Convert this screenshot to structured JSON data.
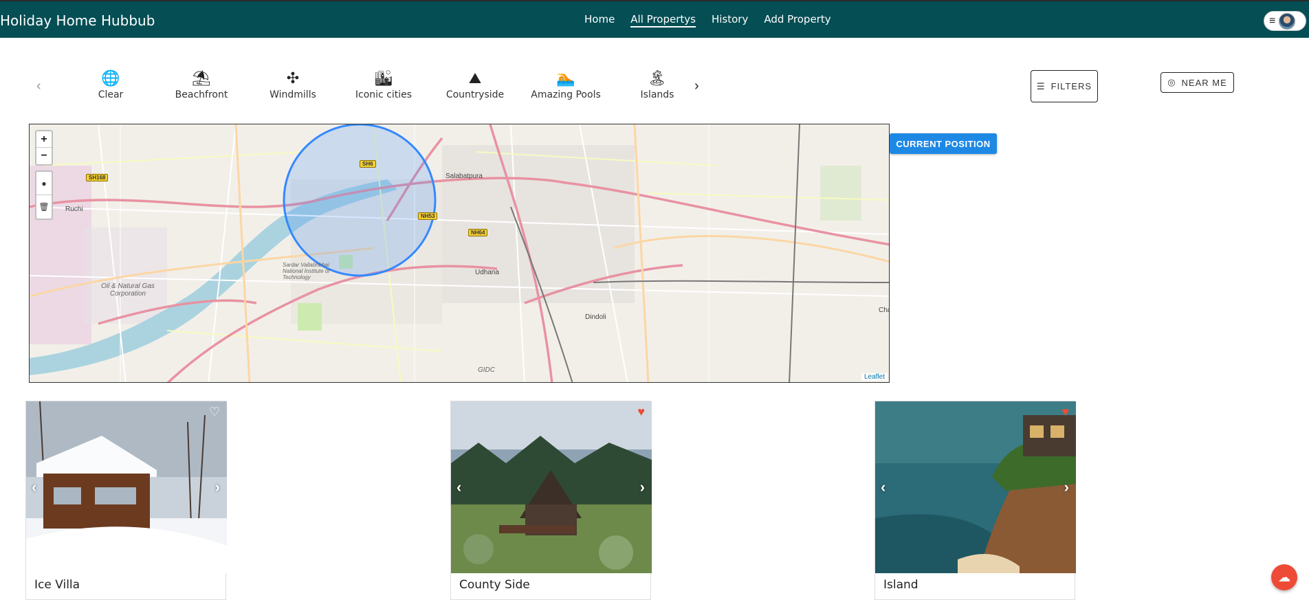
{
  "app": {
    "title": "Holiday Home Hubbub"
  },
  "nav": {
    "items": [
      {
        "label": "Home",
        "active": false
      },
      {
        "label": "All Propertys",
        "active": true
      },
      {
        "label": "History",
        "active": false
      },
      {
        "label": "Add Property",
        "active": false
      }
    ]
  },
  "user_menu": {
    "menu_icon": "hamburger-icon",
    "avatar": "user-avatar"
  },
  "categories": {
    "prev_arrow": "‹",
    "next_arrow": "›",
    "items": [
      {
        "label": "Clear",
        "icon": "globe-icon",
        "glyph": "🌐"
      },
      {
        "label": "Beachfront",
        "icon": "beach-umbrella-icon",
        "glyph": "⛱"
      },
      {
        "label": "Windmills",
        "icon": "windmill-icon",
        "glyph": "✣"
      },
      {
        "label": "Iconic cities",
        "icon": "city-icon",
        "glyph": "🏙"
      },
      {
        "label": "Countryside",
        "icon": "mountain-icon",
        "glyph": "⛰"
      },
      {
        "label": "Amazing Pools",
        "icon": "pool-icon",
        "glyph": "🏊"
      },
      {
        "label": "Islands",
        "icon": "island-icon",
        "glyph": "🏝"
      }
    ]
  },
  "filters_button": {
    "label": "FILTERS",
    "icon": "filter-sliders-icon"
  },
  "near_me_button": {
    "label": "NEAR ME",
    "icon": "location-target-icon"
  },
  "current_position_button": {
    "label": "CURRENT POSITION"
  },
  "map": {
    "zoom_in": "+",
    "zoom_out": "−",
    "draw_marker": "●",
    "draw_delete": "🗑",
    "attribution": "Leaflet",
    "labels": [
      "Salabatpura",
      "Ruchi",
      "Udhana",
      "Dindoli",
      "Oil & Natural Gas Corporation",
      "Sardar Vallabhbhai National Institute of Technology",
      "GIDC",
      "Cha"
    ],
    "shields": [
      "SH168",
      "SH6",
      "NH53",
      "NH64"
    ]
  },
  "properties": [
    {
      "title": "Ice Villa",
      "favorited": false,
      "heart": "♡",
      "image": "snow-cabin-photo"
    },
    {
      "title": "County Side",
      "favorited": true,
      "heart": "♥",
      "image": "forest-cabin-photo"
    },
    {
      "title": "Island",
      "favorited": true,
      "heart": "♥",
      "image": "cliff-house-photo"
    }
  ],
  "card_controls": {
    "prev": "‹",
    "next": "›"
  },
  "colors": {
    "topbar": "#044e54",
    "primary": "#1e88e5",
    "heart_fav": "#ee4b36",
    "fab": "#ee4b36"
  },
  "fab": {
    "icon": "cloud-upload-icon",
    "glyph": "☁"
  }
}
